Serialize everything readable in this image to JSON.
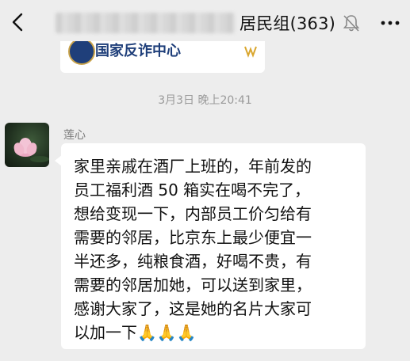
{
  "header": {
    "back_icon": "back-chevron-icon",
    "chat_title": "居民组(363)",
    "mute_icon": "muted-bell-icon",
    "more_icon": "more-dots-icon"
  },
  "shared_card": {
    "name": "国家反诈中心",
    "verified_icon": "verified-check-icon"
  },
  "timestamp": "3月3日 晚上20:41",
  "message": {
    "sender": "莲心",
    "text": "家里亲戚在酒厂上班的，年前发的\n员工福利酒 50 箱实在喝不完了，\n想给变现一下，内部员工价匀给有\n需要的邻居，比京东上最少便宜一\n半还多，纯粮食酒，好喝不贵，有\n需要的邻居加她，可以送到家里，\n感谢大家了，这是她的名片大家可\n以加一下🙏🙏🙏"
  },
  "colors": {
    "background": "#ededed",
    "bubble": "#ffffff",
    "timestamp": "#9a9a9a"
  }
}
